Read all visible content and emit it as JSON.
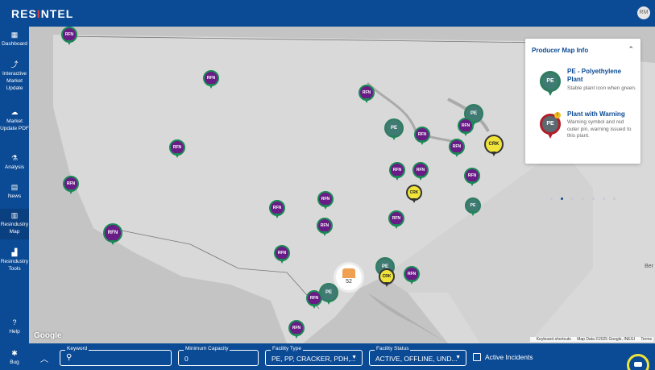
{
  "app": {
    "logo_prefix": "RES",
    "logo_accent": "I",
    "logo_suffix": "NTEL",
    "avatar": "RM"
  },
  "sidebar": {
    "items": [
      {
        "label": "Dashboard",
        "icon": "dashboard-icon"
      },
      {
        "label": "Interactive Market Update",
        "icon": "chart-icon"
      },
      {
        "label": "Market Update PDF",
        "icon": "pdf-icon"
      },
      {
        "label": "Analysis",
        "icon": "flask-icon"
      },
      {
        "label": "News",
        "icon": "news-icon"
      },
      {
        "label": "Resindustry Map",
        "icon": "map-icon"
      },
      {
        "label": "Resindustry Tools",
        "icon": "tools-icon"
      },
      {
        "label": "Help",
        "icon": "help-icon"
      },
      {
        "label": "Bug",
        "icon": "bug-icon"
      }
    ]
  },
  "map": {
    "google": "Google",
    "attribution": {
      "shortcuts": "Keyboard shortcuts",
      "data": "Map Data ©2025 Google, INEGI",
      "terms": "Terms"
    },
    "edge_label": "Ber",
    "cluster_count": "52",
    "pins": [
      {
        "label": "RFN",
        "type": "rfn"
      },
      {
        "label": "RFN",
        "type": "rfn"
      },
      {
        "label": "RFN",
        "type": "rfn"
      },
      {
        "label": "RFN",
        "type": "rfn"
      },
      {
        "label": "RFN",
        "type": "rfn"
      },
      {
        "label": "RFN",
        "type": "rfn"
      },
      {
        "label": "PE",
        "type": "pe"
      },
      {
        "label": "RFN",
        "type": "rfn"
      },
      {
        "label": "PE",
        "type": "pe"
      },
      {
        "label": "RFN",
        "type": "rfn"
      },
      {
        "label": "RFN",
        "type": "rfn"
      },
      {
        "label": "CRK",
        "type": "crk"
      },
      {
        "label": "RFN",
        "type": "rfn"
      },
      {
        "label": "RFN",
        "type": "rfn"
      },
      {
        "label": "RFN",
        "type": "rfn"
      },
      {
        "label": "CRK",
        "type": "crk"
      },
      {
        "label": "PE",
        "type": "pe"
      },
      {
        "label": "RFN",
        "type": "rfn"
      },
      {
        "label": "RFN",
        "type": "rfn"
      },
      {
        "label": "RFN",
        "type": "rfn"
      },
      {
        "label": "RFN",
        "type": "rfn"
      },
      {
        "label": "RFN",
        "type": "rfn"
      },
      {
        "label": "PE",
        "type": "pe"
      },
      {
        "label": "CRK",
        "type": "crk"
      },
      {
        "label": "RFN",
        "type": "rfn"
      },
      {
        "label": "PE",
        "type": "pe"
      },
      {
        "label": "RFN",
        "type": "rfn"
      },
      {
        "label": "RFN",
        "type": "rfn"
      }
    ]
  },
  "info_panel": {
    "title": "Producer Map Info",
    "items": [
      {
        "pin": "PE",
        "title": "PE - Polyethylene Plant",
        "desc": "Stable plant icon when green."
      },
      {
        "pin": "PE",
        "title": "Plant with Warning",
        "desc": "Warning symbol and red outer pin, warning issued to this plant."
      }
    ],
    "page_count": 7,
    "active_page": 1
  },
  "filters": {
    "keyword": {
      "label": "Keyword",
      "value": ""
    },
    "min_capacity": {
      "label": "Minimum Capacity",
      "value": "0"
    },
    "facility_type": {
      "label": "Facility Type",
      "value": "PE, PP, CRACKER, PDH,..."
    },
    "facility_status": {
      "label": "Facility Status",
      "value": "ACTIVE, OFFLINE, UND..."
    },
    "active_incidents": {
      "label": "Active Incidents",
      "checked": false
    }
  },
  "colors": {
    "brand": "#0b4a94",
    "accent": "#e23b3b",
    "rfn": "#6a1c86",
    "pe": "#3f7a73",
    "crk": "#f0e43a",
    "pin_border": "#1a8a55"
  }
}
